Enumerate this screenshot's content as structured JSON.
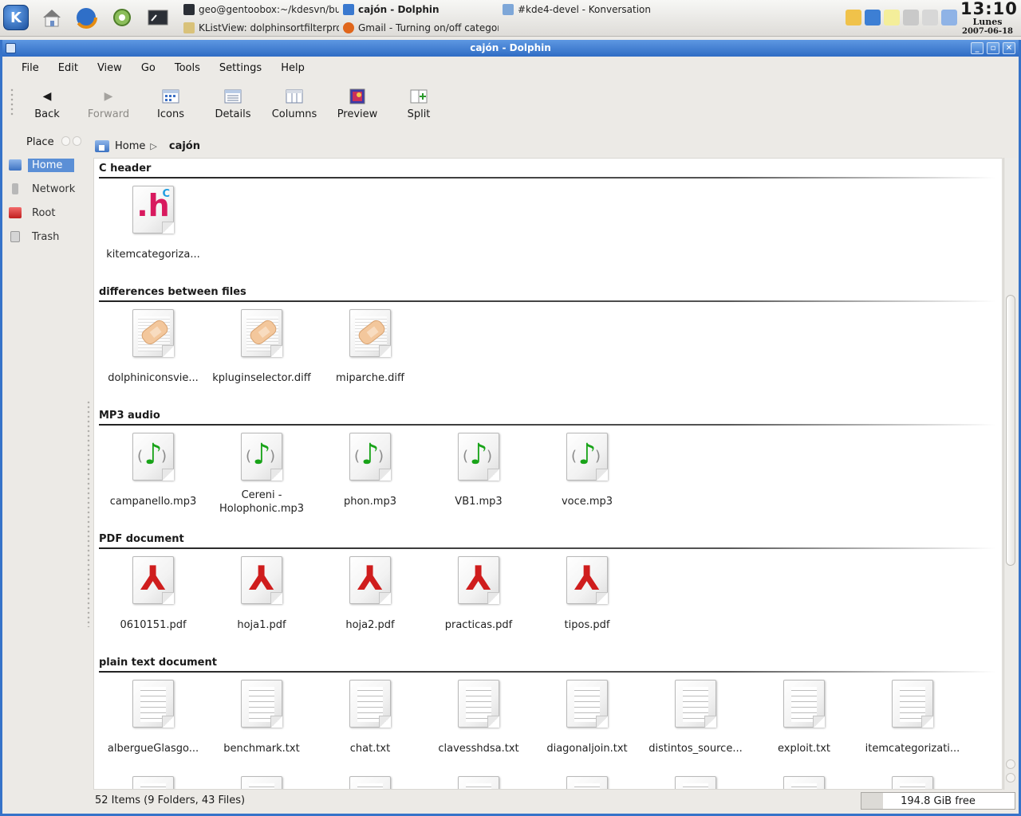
{
  "taskbar": {
    "tasks": [
      {
        "label": "geo@gentoobox:~/kdesvn/buil",
        "active": false
      },
      {
        "label": "cajón - Dolphin",
        "active": true
      },
      {
        "label": "#kde4-devel - Konversation",
        "active": false
      },
      {
        "label": "KListView: dolphinsortfilterpro",
        "active": false
      },
      {
        "label": "Gmail - Turning on/off categor",
        "active": false
      }
    ],
    "clock": {
      "time": "13:10",
      "day": "Lunes",
      "date": "2007-06-18"
    }
  },
  "window": {
    "title": "cajón - Dolphin"
  },
  "menubar": {
    "items": [
      "File",
      "Edit",
      "View",
      "Go",
      "Tools",
      "Settings",
      "Help"
    ]
  },
  "toolbar": {
    "back": "Back",
    "forward": "Forward",
    "icons": "Icons",
    "details": "Details",
    "columns": "Columns",
    "preview": "Preview",
    "split": "Split"
  },
  "places": {
    "title": "Place",
    "items": [
      {
        "label": "Home",
        "selected": true
      },
      {
        "label": "Network",
        "selected": false
      },
      {
        "label": "Root",
        "selected": false
      },
      {
        "label": "Trash",
        "selected": false
      }
    ]
  },
  "breadcrumb": {
    "root": "Home",
    "current": "cajón"
  },
  "categories": [
    {
      "title": "C header",
      "icon": "c-header-icon",
      "files": [
        "kitemcategoriza..."
      ]
    },
    {
      "title": "differences between files",
      "icon": "diff-patch-icon",
      "files": [
        "dolphiniconsvie...",
        "kpluginselector.diff",
        "miparche.diff"
      ]
    },
    {
      "title": "MP3 audio",
      "icon": "audio-note-icon",
      "files": [
        "campanello.mp3",
        "Cereni - Holophonic.mp3",
        "phon.mp3",
        "VB1.mp3",
        "voce.mp3"
      ]
    },
    {
      "title": "PDF document",
      "icon": "pdf-icon",
      "files": [
        "0610151.pdf",
        "hoja1.pdf",
        "hoja2.pdf",
        "practicas.pdf",
        "tipos.pdf"
      ]
    },
    {
      "title": "plain text document",
      "icon": "text-document-icon",
      "files": [
        "albergueGlasgo...",
        "benchmark.txt",
        "chat.txt",
        "clavesshdsa.txt",
        "diagonaljoin.txt",
        "distintos_source...",
        "exploit.txt",
        "itemcategorizati..."
      ]
    }
  ],
  "statusbar": {
    "summary": "52 Items (9 Folders, 43 Files)",
    "free_space": "194.8 GiB free",
    "used_fraction": 0.14
  },
  "colors": {
    "selection": "#5b8fd6",
    "titlebar": "#3673c9",
    "pdf_red": "#cf1d1d",
    "audio_green": "#18a318",
    "header_pink": "#d8195e"
  }
}
